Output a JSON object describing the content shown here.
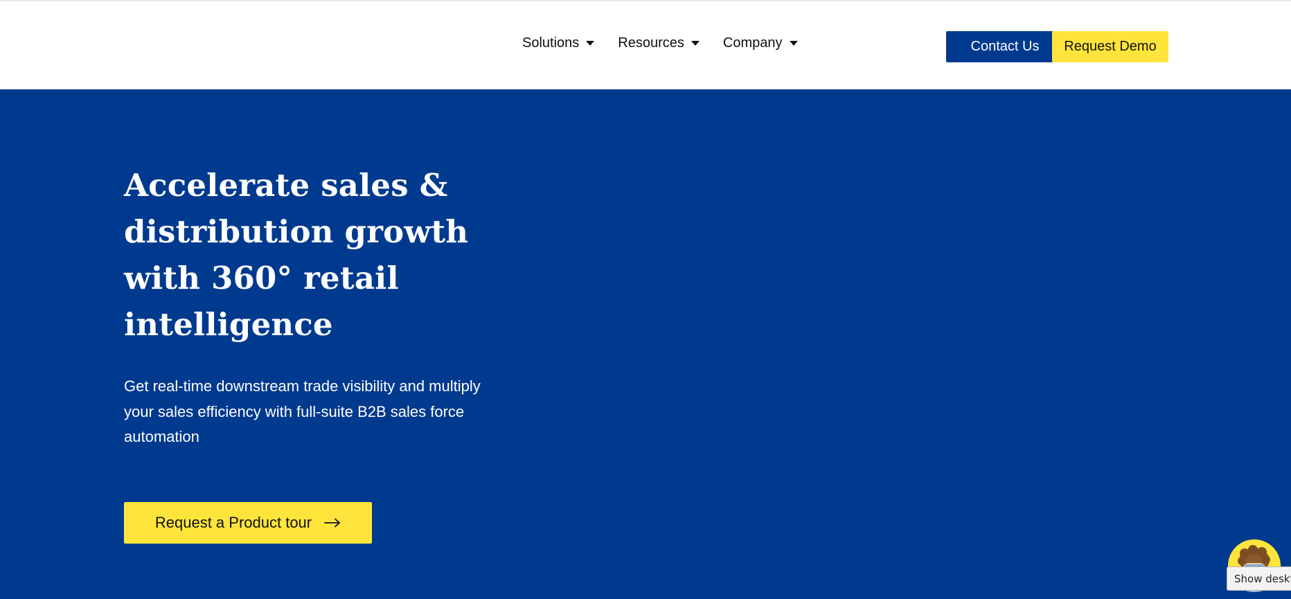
{
  "colors": {
    "brand_blue": "#003a8f",
    "accent_yellow": "#ffe53b",
    "header_bg": "#ffffff",
    "text_dark": "#111111",
    "text_light": "#ffffff"
  },
  "nav": {
    "items": [
      {
        "label": "Solutions",
        "icon": "caret-down-icon"
      },
      {
        "label": "Resources",
        "icon": "caret-down-icon"
      },
      {
        "label": "Company",
        "icon": "caret-down-icon"
      }
    ]
  },
  "header": {
    "contact_label": "Contact Us",
    "demo_label": "Request Demo"
  },
  "hero": {
    "title_lines": [
      "Accelerate sales &",
      "distribution growth",
      "with 360° retail",
      "intelligence"
    ],
    "subtitle_lines": [
      "Get real-time downstream trade visibility and multiply",
      "your sales efficiency with full-suite B2B sales force",
      "automation"
    ],
    "cta_label": "Request a Product tour",
    "cta_icon": "arrow-right-icon"
  },
  "overlay": {
    "avatar_icon": "chat-avatar-icon",
    "tooltip_text": "Show desktop"
  }
}
